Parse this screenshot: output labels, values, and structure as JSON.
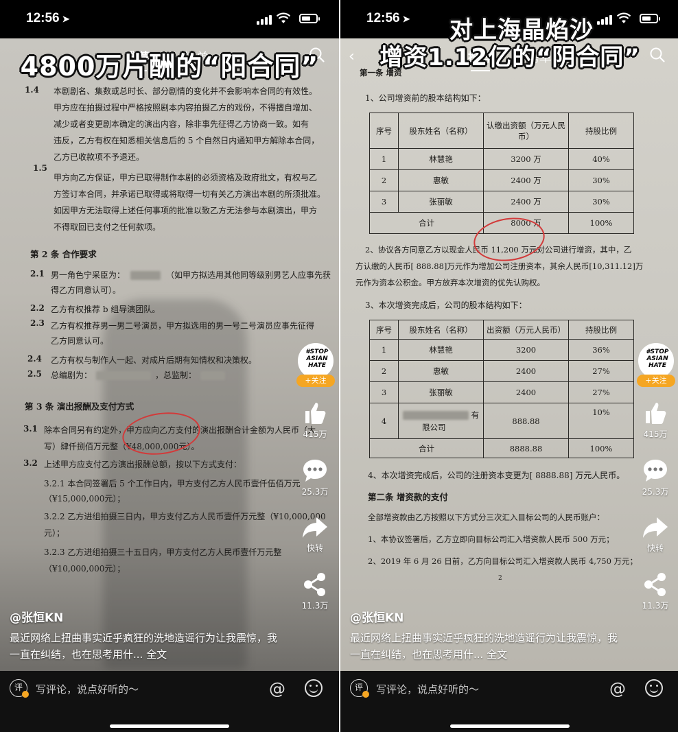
{
  "status": {
    "time": "12:56"
  },
  "tabs": {
    "recommend": "推荐",
    "ranking": "榜单"
  },
  "left": {
    "banner": "4800万片酬的“阳合同”",
    "doc": {
      "n14": "1.4",
      "l1": "本剧剧名、集数或总时长、部分剧情的变化并不会影响本合同的有效性。",
      "l2": "甲方应在拍摄过程中严格按照剧本内容拍摄乙方的戏份，不得擅自增加、",
      "l3": "减少或者变更剧本确定的演出内容，除非事先征得乙方协商一致。如有",
      "l4": "违反，乙方有权在知悉相关信息后的 5 个自然日内通知甲方解除本合同，",
      "l5": "乙方已收款项不予退还。",
      "n15": "1.5",
      "l6": "甲方向乙方保证，甲方已取得制作本剧的必须资格及政府批文，有权与乙",
      "l7": "方签订本合同，并承诺已取得或将取得一切有关乙方演出本剧的所须批准。",
      "l8": "如因甲方无法取得上述任何事项的批准以致乙方无法参与本剧演出，甲方",
      "l9": "不得取回已支付之任何款项。",
      "h2": "第 2 条  合作要求",
      "n21": "2.1",
      "l10a": "男一角色宁采臣为：",
      "l10b": "（如甲方拟选用其他同等级别男艺人应事先获",
      "l11": "得乙方同意认可）。",
      "n22": "2.2",
      "l12": "乙方有权推荐 b 组导演团队。",
      "n23": "2.3",
      "l13": "乙方有权推荐男一男二号演员，甲方拟选用的男一号二号演员应事先征得",
      "l14": "乙方同意认可。",
      "n24": "2.4",
      "l15": "乙方有权与制作人一起、对成片后期有知情权和决策权。",
      "n25": "2.5",
      "l16a": "总编剧为：",
      "l16b": "，总监制：",
      "h3": "第 3 条  演出报酬及支付方式",
      "n31": "3.1",
      "l17": "除本合同另有约定外，甲方应向乙方支付的演出报酬合计金额为人民币（大",
      "l18": "写）肆仟捌佰万元整（¥48,000,000元）。",
      "n32": "3.2",
      "l19": "上述甲方应支付乙方演出报酬总额，按以下方式支付：",
      "l20": "3.2.1 本合同签署后 5 个工作日内，甲方支付乙方人民币壹仟伍佰万元",
      "l21": "（¥15,000,000元）；",
      "l22": "3.2.2  乙方进组拍摄三日内，甲方支付乙方人民币壹仟万元整（¥10,000,000",
      "l23": "元）；",
      "l24": "3.2.3  乙方进组拍摄三十五日内，甲方支付乙方人民币壹仟万元整",
      "l25": "（¥10,000,000元）；"
    },
    "side": {
      "follow": "+关注",
      "likes": "415万",
      "comments": "25.3万",
      "forward": "快转",
      "shares": "11.3万"
    },
    "author": "@张恒KN",
    "caption": "最近网络上扭曲事实近乎疯狂的洗地造谣行为让我震惊，我一直在纠结，也在思考用什... 全文"
  },
  "right": {
    "banner1": "对上海晶焰沙",
    "banner2": "增资1.12亿的“阴合同”",
    "doc": {
      "h1": "第一条  增资",
      "p1": "1、公司增资前的股本结构如下：",
      "t1": {
        "headers": [
          "序号",
          "股东姓名（名称）",
          "认缴出资额（万元人民币）",
          "持股比例"
        ],
        "rows": [
          [
            "1",
            "林慧艳",
            "3200 万",
            "40%"
          ],
          [
            "2",
            "惠敏",
            "2400 万",
            "30%"
          ],
          [
            "3",
            "张丽敏",
            "2400 万",
            "30%"
          ]
        ],
        "total": [
          "合计",
          "8000 万",
          "100%"
        ]
      },
      "p2a": "2、协议各方同意乙方以现金人民币 11,200 万元对公司进行增资，其中，乙",
      "p2b": "方认缴的人民币[ 888.88]万元作为增加公司注册资本，其余人民币[10,311.12]万",
      "p2c": "元作为资本公积金。甲方放弃本次增资的优先认购权。",
      "p3": "3、本次增资完成后，公司的股本结构如下：",
      "t2": {
        "headers": [
          "序号",
          "股东姓名（名称）",
          "出资额（万元人民币）",
          "持股比例"
        ],
        "rows": [
          [
            "1",
            "林慧艳",
            "3200",
            "36%"
          ],
          [
            "2",
            "惠敏",
            "2400",
            "27%"
          ],
          [
            "3",
            "张丽敏",
            "2400",
            "27%"
          ]
        ],
        "row4": [
          "4",
          "有",
          "限公司",
          "888.88",
          "10%"
        ],
        "total": [
          "合计",
          "8888.88",
          "100%"
        ]
      },
      "p4": "4、本次增资完成后，公司的注册资本变更为[ 8888.88] 万元人民币。",
      "h2": "第二条  增资款的支付",
      "p5": "全部增资款由乙方按照以下方式分三次汇入目标公司的人民币账户：",
      "p6": "1、本协议签署后，乙方立即向目标公司汇入增资款人民币 500 万元；",
      "p7": "2、2019 年 6 月 26 日前，乙方向目标公司汇入增资款人民币 4,750 万元；",
      "pageno": "2"
    },
    "side": {
      "follow": "+关注",
      "likes": "415万",
      "comments": "25.3万",
      "forward": "快转",
      "shares": "11.3万"
    },
    "author": "@张恒KN",
    "caption": "最近网络上扭曲事实近乎疯狂的洗地造谣行为让我震惊，我一直在纠结，也在思考用什... 全文"
  },
  "comment_bar": {
    "icon": "评",
    "placeholder": "写评论，说点好听的～",
    "at": "@"
  },
  "avatar_text": "#STOP ASIAN HATE"
}
